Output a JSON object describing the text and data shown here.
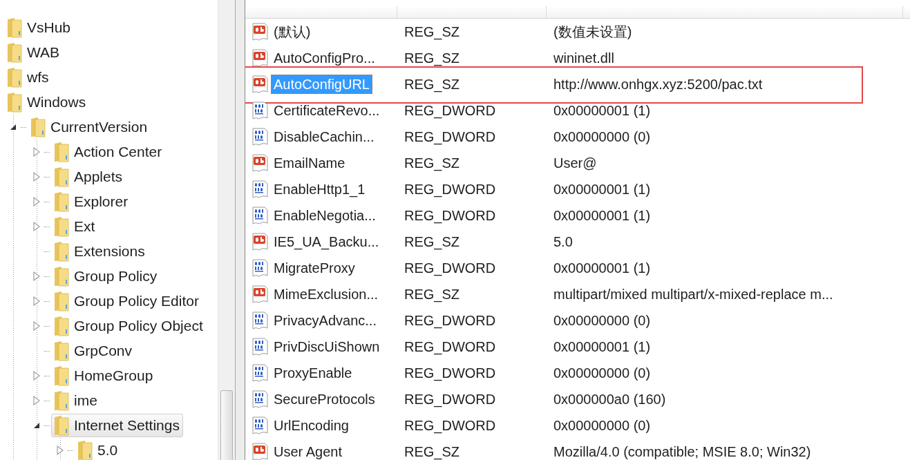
{
  "tree": [
    {
      "label": "VsHub",
      "selected": false
    },
    {
      "label": "WAB",
      "selected": false
    },
    {
      "label": "wfs",
      "selected": false
    },
    {
      "label": "Windows",
      "selected": false,
      "children": [
        {
          "label": "CurrentVersion",
          "selected": false,
          "expandable": true,
          "expanded": true,
          "children": [
            {
              "label": "Action Center",
              "selected": false,
              "expandable": true,
              "expanded": false
            },
            {
              "label": "Applets",
              "selected": false,
              "expandable": true,
              "expanded": false
            },
            {
              "label": "Explorer",
              "selected": false,
              "expandable": true,
              "expanded": false
            },
            {
              "label": "Ext",
              "selected": false,
              "expandable": true,
              "expanded": false
            },
            {
              "label": "Extensions",
              "selected": false,
              "expandable": false
            },
            {
              "label": "Group Policy",
              "selected": false,
              "expandable": true,
              "expanded": false
            },
            {
              "label": "Group Policy Editor",
              "selected": false,
              "expandable": true,
              "expanded": false
            },
            {
              "label": "Group Policy Object",
              "selected": false,
              "expandable": true,
              "expanded": false
            },
            {
              "label": "GrpConv",
              "selected": false,
              "expandable": false
            },
            {
              "label": "HomeGroup",
              "selected": false,
              "expandable": true,
              "expanded": false
            },
            {
              "label": "ime",
              "selected": false,
              "expandable": true,
              "expanded": false
            },
            {
              "label": "Internet Settings",
              "selected": true,
              "expandable": true,
              "expanded": true,
              "children": [
                {
                  "label": "5.0",
                  "selected": false,
                  "expandable": true,
                  "expanded": false
                }
              ]
            }
          ]
        }
      ]
    }
  ],
  "values": {
    "rows": [
      {
        "kind": "string",
        "name": "(默认)",
        "type": "REG_SZ",
        "data": "(数值未设置)",
        "selected": false,
        "outlined": false
      },
      {
        "kind": "string",
        "name": "AutoConfigPro...",
        "type": "REG_SZ",
        "data": "wininet.dll",
        "selected": false,
        "outlined": false
      },
      {
        "kind": "string",
        "name": "AutoConfigURL",
        "type": "REG_SZ",
        "data": "http://www.onhgx.xyz:5200/pac.txt",
        "selected": true,
        "outlined": true
      },
      {
        "kind": "binary",
        "name": "CertificateRevo...",
        "type": "REG_DWORD",
        "data": "0x00000001 (1)",
        "selected": false,
        "outlined": false
      },
      {
        "kind": "binary",
        "name": "DisableCachin...",
        "type": "REG_DWORD",
        "data": "0x00000000 (0)",
        "selected": false,
        "outlined": false
      },
      {
        "kind": "string",
        "name": "EmailName",
        "type": "REG_SZ",
        "data": "User@",
        "selected": false,
        "outlined": false
      },
      {
        "kind": "binary",
        "name": "EnableHttp1_1",
        "type": "REG_DWORD",
        "data": "0x00000001 (1)",
        "selected": false,
        "outlined": false
      },
      {
        "kind": "binary",
        "name": "EnableNegotia...",
        "type": "REG_DWORD",
        "data": "0x00000001 (1)",
        "selected": false,
        "outlined": false
      },
      {
        "kind": "string",
        "name": "IE5_UA_Backu...",
        "type": "REG_SZ",
        "data": "5.0",
        "selected": false,
        "outlined": false
      },
      {
        "kind": "binary",
        "name": "MigrateProxy",
        "type": "REG_DWORD",
        "data": "0x00000001 (1)",
        "selected": false,
        "outlined": false
      },
      {
        "kind": "string",
        "name": "MimeExclusion...",
        "type": "REG_SZ",
        "data": "multipart/mixed multipart/x-mixed-replace m...",
        "selected": false,
        "outlined": false
      },
      {
        "kind": "binary",
        "name": "PrivacyAdvanc...",
        "type": "REG_DWORD",
        "data": "0x00000000 (0)",
        "selected": false,
        "outlined": false
      },
      {
        "kind": "binary",
        "name": "PrivDiscUiShown",
        "type": "REG_DWORD",
        "data": "0x00000001 (1)",
        "selected": false,
        "outlined": false
      },
      {
        "kind": "binary",
        "name": "ProxyEnable",
        "type": "REG_DWORD",
        "data": "0x00000000 (0)",
        "selected": false,
        "outlined": false
      },
      {
        "kind": "binary",
        "name": "SecureProtocols",
        "type": "REG_DWORD",
        "data": "0x000000a0 (160)",
        "selected": false,
        "outlined": false
      },
      {
        "kind": "binary",
        "name": "UrlEncoding",
        "type": "REG_DWORD",
        "data": "0x00000000 (0)",
        "selected": false,
        "outlined": false
      },
      {
        "kind": "string",
        "name": "User Agent",
        "type": "REG_SZ",
        "data": "Mozilla/4.0 (compatible; MSIE 8.0; Win32)",
        "selected": false,
        "outlined": false
      }
    ]
  }
}
